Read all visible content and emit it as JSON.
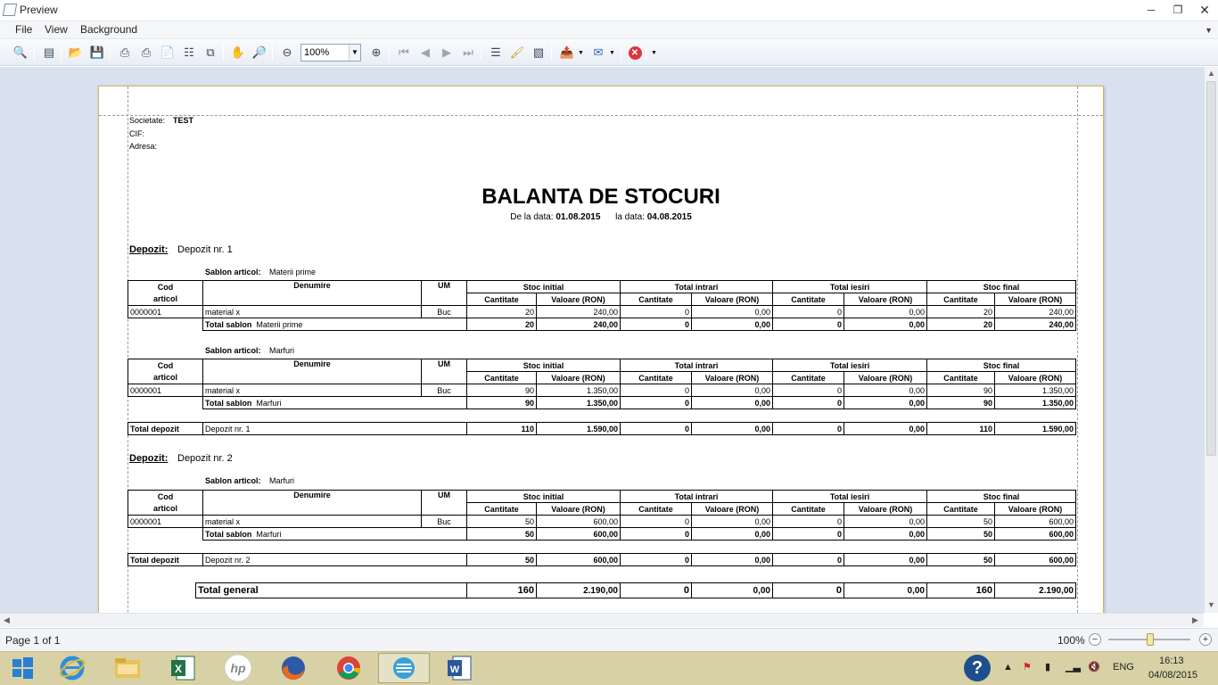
{
  "window": {
    "title": "Preview"
  },
  "menu": {
    "items": [
      "File",
      "View",
      "Background"
    ]
  },
  "toolbar": {
    "zoom": "100%"
  },
  "report": {
    "company_label": "Societate:",
    "company_value": "TEST",
    "cif_label": "CIF:",
    "address_label": "Adresa:",
    "title": "BALANTA DE STOCURI",
    "from_label": "De la data:",
    "from_date": "01.08.2015",
    "to_label": "la data:",
    "to_date": "04.08.2015",
    "dep_label": "Depozit:",
    "sablon_label": "Sablon articol:",
    "headers": {
      "cod": "Cod",
      "articol": "articol",
      "denumire": "Denumire",
      "um": "UM",
      "stoc_initial": "Stoc initial",
      "total_intrari": "Total intrari",
      "total_iesiri": "Total iesiri",
      "stoc_final": "Stoc final",
      "cantitate": "Cantitate",
      "valoare": "Valoare (RON)"
    },
    "total_sablon_label": "Total sablon",
    "total_depozit_label": "Total depozit",
    "total_general_label": "Total general",
    "deposits": [
      {
        "name": "Depozit nr. 1",
        "groups": [
          {
            "sablon": "Materii prime",
            "row": {
              "cod": "0000001",
              "den": "material x",
              "um": "Buc",
              "v": [
                "20",
                "240,00",
                "0",
                "0,00",
                "0",
                "0,00",
                "20",
                "240,00"
              ]
            },
            "tot": [
              "20",
              "240,00",
              "0",
              "0,00",
              "0",
              "0,00",
              "20",
              "240,00"
            ]
          },
          {
            "sablon": "Marfuri",
            "row": {
              "cod": "0000001",
              "den": "material x",
              "um": "Buc",
              "v": [
                "90",
                "1.350,00",
                "0",
                "0,00",
                "0",
                "0,00",
                "90",
                "1.350,00"
              ]
            },
            "tot": [
              "90",
              "1.350,00",
              "0",
              "0,00",
              "0",
              "0,00",
              "90",
              "1.350,00"
            ]
          }
        ],
        "total": [
          "110",
          "1.590,00",
          "0",
          "0,00",
          "0",
          "0,00",
          "110",
          "1.590,00"
        ]
      },
      {
        "name": "Depozit nr. 2",
        "groups": [
          {
            "sablon": "Marfuri",
            "row": {
              "cod": "0000001",
              "den": "material x",
              "um": "Buc",
              "v": [
                "50",
                "600,00",
                "0",
                "0,00",
                "0",
                "0,00",
                "50",
                "600,00"
              ]
            },
            "tot": [
              "50",
              "600,00",
              "0",
              "0,00",
              "0",
              "0,00",
              "50",
              "600,00"
            ]
          }
        ],
        "total": [
          "50",
          "600,00",
          "0",
          "0,00",
          "0",
          "0,00",
          "50",
          "600,00"
        ]
      }
    ],
    "general": [
      "160",
      "2.190,00",
      "0",
      "0,00",
      "0",
      "0,00",
      "160",
      "2.190,00"
    ]
  },
  "status": {
    "page": "Page 1 of 1",
    "zoom": "100%"
  },
  "taskbar": {
    "lang": "ENG",
    "time": "16:13",
    "date": "04/08/2015"
  }
}
